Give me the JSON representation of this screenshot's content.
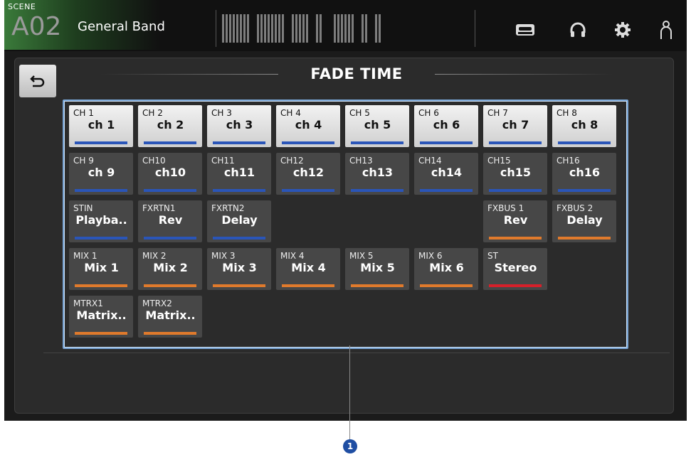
{
  "header": {
    "scene_tag": "SCENE",
    "scene_number": "A02",
    "scene_title": "General Band",
    "icons": [
      "recorder-icon",
      "headphones-icon",
      "gear-icon",
      "user-icon"
    ]
  },
  "page": {
    "title": "FADE TIME",
    "back_icon": "back-arrow-icon"
  },
  "colors": {
    "blue": "#2a55b8",
    "orange": "#e07a2c",
    "red": "#d6202a",
    "selected": "#e3e3e3",
    "unselected": "#474747",
    "frame": "#7aa7d8"
  },
  "channels": [
    {
      "id": "CH 1",
      "name": "ch 1",
      "color": "blue",
      "selected": true
    },
    {
      "id": "CH 2",
      "name": "ch 2",
      "color": "blue",
      "selected": true
    },
    {
      "id": "CH 3",
      "name": "ch 3",
      "color": "blue",
      "selected": true
    },
    {
      "id": "CH 4",
      "name": "ch 4",
      "color": "blue",
      "selected": true
    },
    {
      "id": "CH 5",
      "name": "ch 5",
      "color": "blue",
      "selected": true
    },
    {
      "id": "CH 6",
      "name": "ch 6",
      "color": "blue",
      "selected": true
    },
    {
      "id": "CH 7",
      "name": "ch 7",
      "color": "blue",
      "selected": true
    },
    {
      "id": "CH 8",
      "name": "ch 8",
      "color": "blue",
      "selected": true
    },
    {
      "id": "CH 9",
      "name": "ch 9",
      "color": "blue",
      "selected": false
    },
    {
      "id": "CH10",
      "name": "ch10",
      "color": "blue",
      "selected": false
    },
    {
      "id": "CH11",
      "name": "ch11",
      "color": "blue",
      "selected": false
    },
    {
      "id": "CH12",
      "name": "ch12",
      "color": "blue",
      "selected": false
    },
    {
      "id": "CH13",
      "name": "ch13",
      "color": "blue",
      "selected": false
    },
    {
      "id": "CH14",
      "name": "ch14",
      "color": "blue",
      "selected": false
    },
    {
      "id": "CH15",
      "name": "ch15",
      "color": "blue",
      "selected": false
    },
    {
      "id": "CH16",
      "name": "ch16",
      "color": "blue",
      "selected": false
    },
    {
      "id": "STIN",
      "name": "Playba..",
      "color": "blue",
      "selected": false
    },
    {
      "id": "FXRTN1",
      "name": "Rev",
      "color": "blue",
      "selected": false
    },
    {
      "id": "FXRTN2",
      "name": "Delay",
      "color": "blue",
      "selected": false
    },
    {
      "id": "FXBUS 1",
      "name": "Rev",
      "color": "orange",
      "selected": false
    },
    {
      "id": "FXBUS 2",
      "name": "Delay",
      "color": "orange",
      "selected": false
    },
    {
      "id": "MIX 1",
      "name": "Mix 1",
      "color": "orange",
      "selected": false
    },
    {
      "id": "MIX 2",
      "name": "Mix 2",
      "color": "orange",
      "selected": false
    },
    {
      "id": "MIX 3",
      "name": "Mix 3",
      "color": "orange",
      "selected": false
    },
    {
      "id": "MIX 4",
      "name": "Mix 4",
      "color": "orange",
      "selected": false
    },
    {
      "id": "MIX 5",
      "name": "Mix 5",
      "color": "orange",
      "selected": false
    },
    {
      "id": "MIX 6",
      "name": "Mix 6",
      "color": "orange",
      "selected": false
    },
    {
      "id": "ST",
      "name": "Stereo",
      "color": "red",
      "selected": false
    },
    {
      "id": "MTRX1",
      "name": "Matrix..",
      "color": "orange",
      "selected": false
    },
    {
      "id": "MTRX2",
      "name": "Matrix..",
      "color": "orange",
      "selected": false
    }
  ],
  "callout": {
    "label": "1"
  }
}
